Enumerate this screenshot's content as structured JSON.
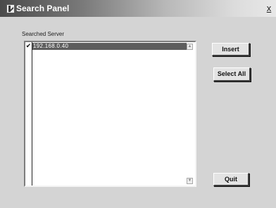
{
  "window": {
    "title": "Search Panel",
    "close_label": "x"
  },
  "server_list": {
    "label": "Searched Server",
    "items": [
      {
        "address": "192.168.0.40",
        "checked": true,
        "selected": true
      }
    ]
  },
  "buttons": {
    "insert": "Insert",
    "select_all": "Select All",
    "quit": "Quit"
  }
}
